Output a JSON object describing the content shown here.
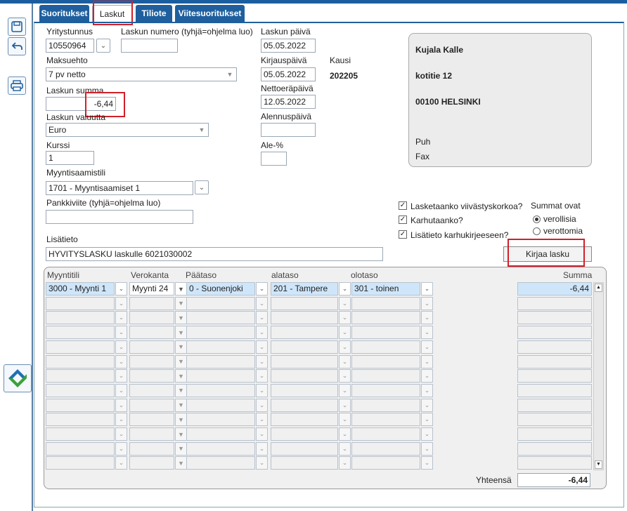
{
  "tabs": [
    "Suoritukset",
    "Laskut",
    "Tiliote",
    "Viitesuoritukset"
  ],
  "form": {
    "yritystunnus_label": "Yritystunnus",
    "yritystunnus": "10550964",
    "laskun_numero_label": "Laskun numero (tyhjä=ohjelma luo)",
    "laskun_numero": "",
    "laskun_paiva_label": "Laskun päivä",
    "laskun_paiva": "05.05.2022",
    "maksuehto_label": "Maksuehto",
    "maksuehto": "7 pv netto",
    "kirjauspaiva_label": "Kirjauspäivä",
    "kirjauspaiva": "05.05.2022",
    "kausi_label": "Kausi",
    "kausi": "202205",
    "laskun_summa_label": "Laskun summa",
    "laskun_summa": "-6,44",
    "nettoerapaiva_label": "Nettoeräpäivä",
    "nettoerapaiva": "12.05.2022",
    "valuutta_label": "Laskun valuutta",
    "valuutta": "Euro",
    "alennuspaiva_label": "Alennuspäivä",
    "alennuspaiva": "",
    "kurssi_label": "Kurssi",
    "kurssi": "1",
    "ale_label": "Ale-%",
    "ale": "",
    "myyntisaamistili_label": "Myyntisaamistili",
    "myyntisaamistili": "1701 - Myyntisaamiset 1",
    "pankkiviite_label": "Pankkiviite (tyhjä=ohjelma luo)",
    "pankkiviite": "",
    "lisatieto_label": "Lisätieto",
    "lisatieto": "HYVITYSLASKU laskulle 6021030002"
  },
  "address": {
    "name": "Kujala Kalle",
    "street": "kotitie 12",
    "city": "00100 HELSINKI",
    "puh": "Puh",
    "fax": "Fax"
  },
  "options": {
    "viivastyskorko": "Lasketaanko viivästyskorkoa?",
    "karhutaanko": "Karhutaanko?",
    "lisatieto_karhu": "Lisätieto karhukirjeeseen?",
    "summat_ovat": "Summat ovat",
    "verollisia": "verollisia",
    "verottomia": "verottomia"
  },
  "kirjaa_button": "Kirjaa lasku",
  "grid": {
    "headers": [
      "Myyntitili",
      "Verokanta",
      "Päätaso",
      "alataso",
      "olotaso",
      "Summa"
    ],
    "row1": [
      "3000 - Myynti 1",
      "Myynti 24",
      "0 - Suonenjoki",
      "201 - Tampere",
      "301 - toinen",
      "-6,44"
    ],
    "total_label": "Yhteensä",
    "total": "-6,44"
  }
}
